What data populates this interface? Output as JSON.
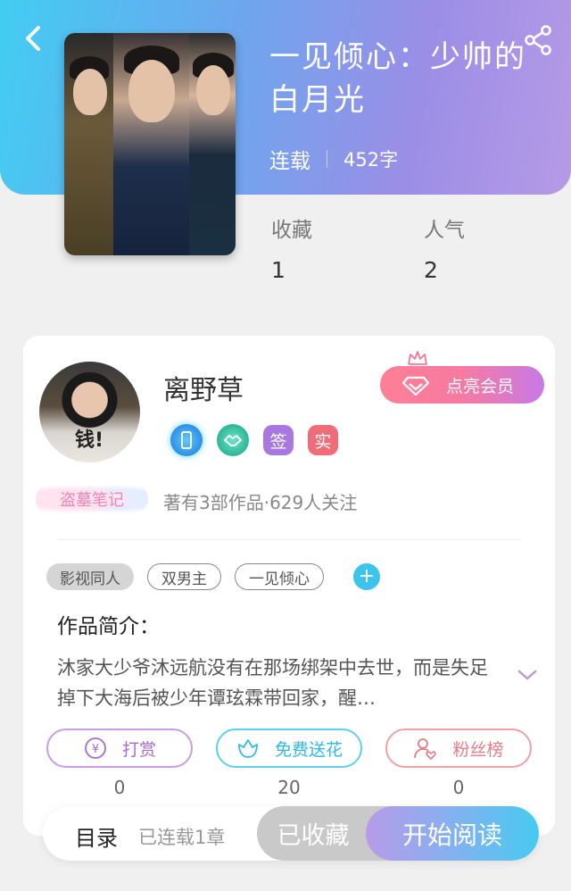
{
  "header": {
    "back_icon": "chevron-left-icon",
    "share_icon": "share-icon",
    "gradient": [
      "#42cdf2",
      "#b69ae6"
    ]
  },
  "book": {
    "title": "一见倾心：少帅的白月光",
    "status": "连载",
    "word_count": "452字",
    "cover_icon": "book-cover-image"
  },
  "stats": [
    {
      "label": "收藏",
      "value": "1"
    },
    {
      "label": "人气",
      "value": "2"
    }
  ],
  "author": {
    "name": "离野草",
    "avatar_text": "钱!",
    "vip_button": "点亮会员",
    "badges": [
      {
        "icon": "phone-badge-icon"
      },
      {
        "icon": "handshake-badge-icon"
      },
      {
        "icon": "signed-badge-icon",
        "text": "签"
      },
      {
        "icon": "verified-badge-icon",
        "text": "实"
      }
    ],
    "tag": "盗墓笔记",
    "summary": "著有3部作品·629人关注"
  },
  "tags": {
    "items": [
      "影视同人",
      "双男主",
      "一见倾心"
    ],
    "add_label": "+"
  },
  "intro": {
    "title": "作品简介：",
    "text": "沐家大少爷沐远航没有在那场绑架中去世，而是失足掉下大海后被少年谭玹霖带回家，醒…"
  },
  "actions": [
    {
      "label": "打赏",
      "count": "0",
      "icon": "yen-coin-icon",
      "color": "#a76bd8"
    },
    {
      "label": "免费送花",
      "count": "20",
      "icon": "flower-icon",
      "color": "#2fbbe3"
    },
    {
      "label": "粉丝榜",
      "count": "0",
      "icon": "fan-user-icon",
      "color": "#e77b86"
    }
  ],
  "bottom_bar": {
    "toc_label": "目录",
    "toc_sub": "已连载1章",
    "collected_label": "已收藏",
    "read_label": "开始阅读"
  }
}
